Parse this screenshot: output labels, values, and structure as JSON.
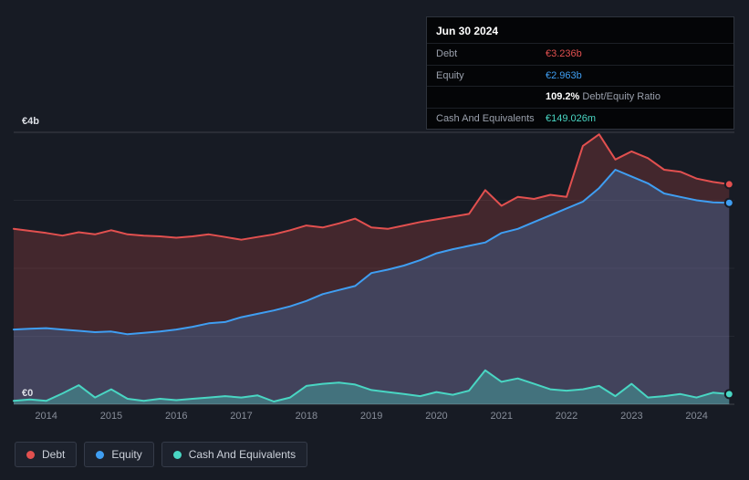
{
  "colors": {
    "background": "#171b24",
    "debt": "#e2504f",
    "equity": "#3f9ef2",
    "cash": "#49d6c3"
  },
  "tooltip": {
    "date": "Jun 30 2024",
    "debt_label": "Debt",
    "debt_value": "€3.236b",
    "equity_label": "Equity",
    "equity_value": "€2.963b",
    "ratio_value": "109.2%",
    "ratio_label": "Debt/Equity Ratio",
    "cash_label": "Cash And Equivalents",
    "cash_value": "€149.026m"
  },
  "legend": {
    "debt": "Debt",
    "equity": "Equity",
    "cash": "Cash And Equivalents"
  },
  "chart_data": {
    "type": "area",
    "title": "",
    "xlabel": "",
    "ylabel": "",
    "legend_position": "bottom-left",
    "grid": true,
    "xlim": [
      2013.5,
      2024.58
    ],
    "ylim": [
      0,
      4
    ],
    "x_ticks": [
      2014,
      2015,
      2016,
      2017,
      2018,
      2019,
      2020,
      2021,
      2022,
      2023,
      2024
    ],
    "y_ticks": [
      {
        "value": 4,
        "label": "€4b"
      },
      {
        "value": 0,
        "label": "€0"
      }
    ],
    "y_gridlines": [
      0,
      1,
      2,
      3,
      4
    ],
    "x": [
      2013.5,
      2013.75,
      2014,
      2014.25,
      2014.5,
      2014.75,
      2015,
      2015.25,
      2015.5,
      2015.75,
      2016,
      2016.25,
      2016.5,
      2016.75,
      2017,
      2017.25,
      2017.5,
      2017.75,
      2018,
      2018.25,
      2018.5,
      2018.75,
      2019,
      2019.25,
      2019.5,
      2019.75,
      2020,
      2020.25,
      2020.5,
      2020.75,
      2021,
      2021.25,
      2021.5,
      2021.75,
      2022,
      2022.25,
      2022.5,
      2022.75,
      2023,
      2023.25,
      2023.5,
      2023.75,
      2024,
      2024.25,
      2024.5
    ],
    "series": [
      {
        "name": "Debt",
        "color_key": "debt",
        "fill_opacity": 0.22,
        "unit": "€b",
        "values": [
          2.58,
          2.55,
          2.52,
          2.48,
          2.53,
          2.5,
          2.56,
          2.5,
          2.48,
          2.47,
          2.45,
          2.47,
          2.5,
          2.46,
          2.42,
          2.46,
          2.5,
          2.56,
          2.63,
          2.6,
          2.66,
          2.73,
          2.6,
          2.58,
          2.63,
          2.68,
          2.72,
          2.76,
          2.8,
          3.15,
          2.92,
          3.05,
          3.02,
          3.08,
          3.05,
          3.8,
          3.97,
          3.6,
          3.72,
          3.62,
          3.45,
          3.42,
          3.32,
          3.27,
          3.236
        ]
      },
      {
        "name": "Equity",
        "color_key": "equity",
        "fill_opacity": 0.24,
        "unit": "€b",
        "values": [
          1.1,
          1.11,
          1.12,
          1.1,
          1.08,
          1.06,
          1.07,
          1.03,
          1.05,
          1.07,
          1.1,
          1.14,
          1.19,
          1.21,
          1.28,
          1.33,
          1.38,
          1.44,
          1.52,
          1.62,
          1.68,
          1.74,
          1.93,
          1.98,
          2.04,
          2.12,
          2.22,
          2.28,
          2.33,
          2.38,
          2.52,
          2.58,
          2.68,
          2.78,
          2.88,
          2.98,
          3.18,
          3.45,
          3.35,
          3.25,
          3.1,
          3.05,
          3.0,
          2.97,
          2.963
        ]
      },
      {
        "name": "Cash And Equivalents",
        "color_key": "cash",
        "fill_opacity": 0.32,
        "unit": "€b",
        "values": [
          0.05,
          0.07,
          0.05,
          0.16,
          0.28,
          0.1,
          0.22,
          0.08,
          0.05,
          0.08,
          0.06,
          0.08,
          0.1,
          0.12,
          0.1,
          0.13,
          0.04,
          0.1,
          0.27,
          0.3,
          0.32,
          0.29,
          0.21,
          0.18,
          0.15,
          0.12,
          0.18,
          0.14,
          0.2,
          0.5,
          0.33,
          0.38,
          0.3,
          0.22,
          0.2,
          0.22,
          0.27,
          0.12,
          0.3,
          0.1,
          0.12,
          0.15,
          0.1,
          0.17,
          0.149
        ]
      }
    ]
  }
}
